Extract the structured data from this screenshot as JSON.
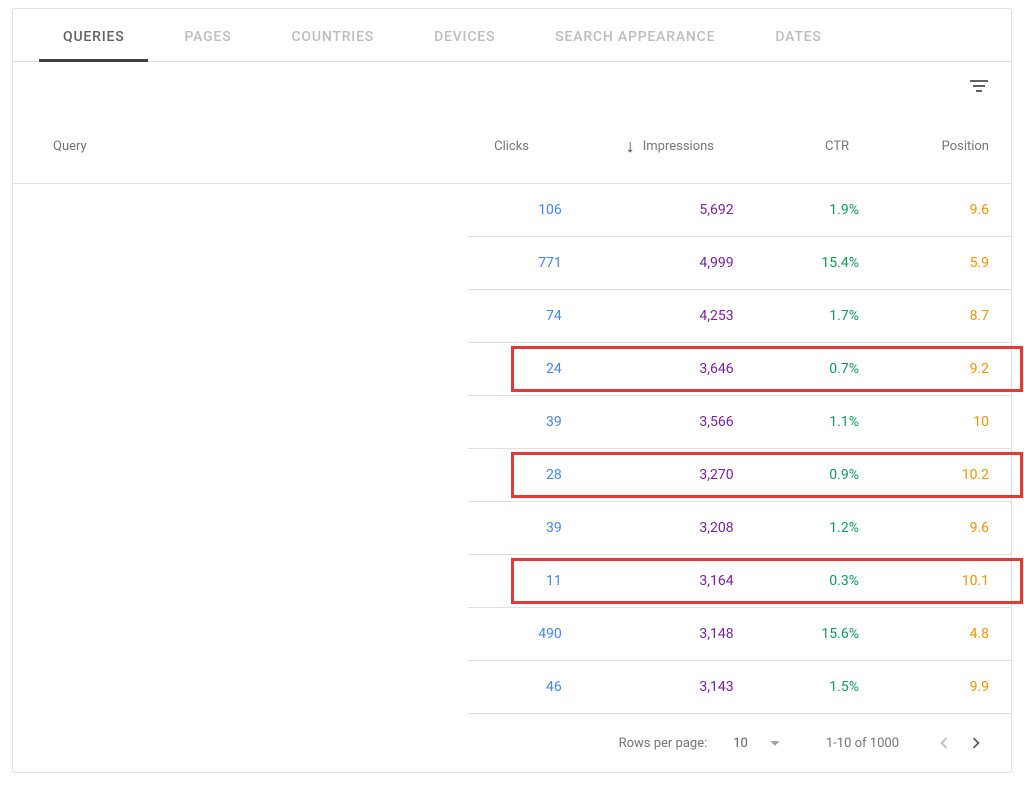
{
  "tabs": [
    {
      "label": "QUERIES",
      "active": true
    },
    {
      "label": "PAGES",
      "active": false
    },
    {
      "label": "COUNTRIES",
      "active": false
    },
    {
      "label": "DEVICES",
      "active": false
    },
    {
      "label": "SEARCH APPEARANCE",
      "active": false
    },
    {
      "label": "DATES",
      "active": false
    }
  ],
  "headers": {
    "query": "Query",
    "clicks": "Clicks",
    "impressions": "Impressions",
    "ctr": "CTR",
    "position": "Position"
  },
  "sort": {
    "column": "impressions",
    "direction": "desc"
  },
  "rows": [
    {
      "clicks": "106",
      "impressions": "5,692",
      "ctr": "1.9%",
      "position": "9.6",
      "highlight": false
    },
    {
      "clicks": "771",
      "impressions": "4,999",
      "ctr": "15.4%",
      "position": "5.9",
      "highlight": false
    },
    {
      "clicks": "74",
      "impressions": "4,253",
      "ctr": "1.7%",
      "position": "8.7",
      "highlight": false
    },
    {
      "clicks": "24",
      "impressions": "3,646",
      "ctr": "0.7%",
      "position": "9.2",
      "highlight": true
    },
    {
      "clicks": "39",
      "impressions": "3,566",
      "ctr": "1.1%",
      "position": "10",
      "highlight": false
    },
    {
      "clicks": "28",
      "impressions": "3,270",
      "ctr": "0.9%",
      "position": "10.2",
      "highlight": true
    },
    {
      "clicks": "39",
      "impressions": "3,208",
      "ctr": "1.2%",
      "position": "9.6",
      "highlight": false
    },
    {
      "clicks": "11",
      "impressions": "3,164",
      "ctr": "0.3%",
      "position": "10.1",
      "highlight": true
    },
    {
      "clicks": "490",
      "impressions": "3,148",
      "ctr": "15.6%",
      "position": "4.8",
      "highlight": false
    },
    {
      "clicks": "46",
      "impressions": "3,143",
      "ctr": "1.5%",
      "position": "9.9",
      "highlight": false
    }
  ],
  "pagination": {
    "rows_per_page_label": "Rows per page:",
    "rows_per_page_value": "10",
    "range": "1-10 of 1000"
  },
  "colors": {
    "clicks": "#4285f4",
    "impressions": "#7b1fa2",
    "ctr": "#0f9d58",
    "position": "#f09300",
    "highlight_border": "#e53935"
  }
}
